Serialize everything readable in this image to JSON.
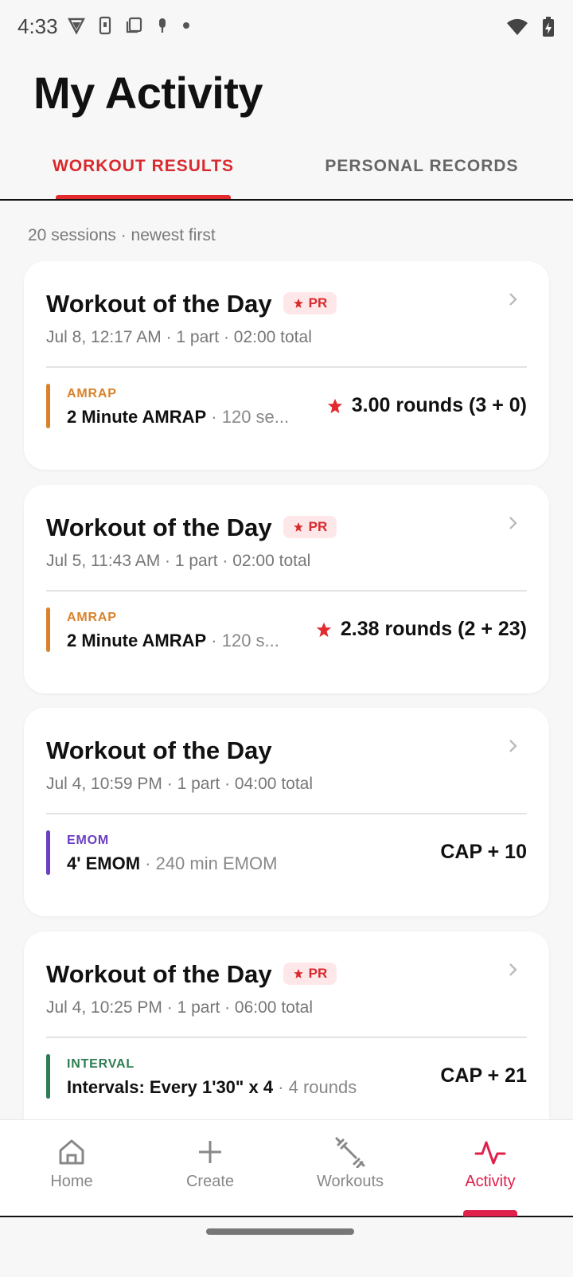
{
  "status_bar": {
    "time": "4:33"
  },
  "page": {
    "title": "My Activity"
  },
  "tabs": [
    {
      "label": "WORKOUT RESULTS",
      "active": true
    },
    {
      "label": "PERSONAL RECORDS",
      "active": false
    }
  ],
  "list_meta": "20 sessions · newest first",
  "cards": [
    {
      "title": "Workout of the Day",
      "badge": "PR",
      "subtitle": "Jul 8, 12:17 AM · 1 part · 02:00 total",
      "part_type": "AMRAP",
      "part_color": "#d9822b",
      "part_name": "2 Minute AMRAP",
      "part_desc": " · 120 se...",
      "score": "3.00 rounds (3 + 0)",
      "score_pr": true
    },
    {
      "title": "Workout of the Day",
      "badge": "PR",
      "subtitle": "Jul 5, 11:43 AM · 1 part · 02:00 total",
      "part_type": "AMRAP",
      "part_color": "#d9822b",
      "part_name": "2 Minute AMRAP",
      "part_desc": " · 120 s...",
      "score": "2.38 rounds (2 + 23)",
      "score_pr": true
    },
    {
      "title": "Workout of the Day",
      "subtitle": "Jul 4, 10:59 PM · 1 part · 04:00 total",
      "part_type": "EMOM",
      "part_color": "#6a3fc1",
      "part_name": "4' EMOM",
      "part_desc": " · 240 min EMOM",
      "score": "CAP + 10",
      "score_pr": false
    },
    {
      "title": "Workout of the Day",
      "badge": "PR",
      "subtitle": "Jul 4, 10:25 PM · 1 part · 06:00 total",
      "part_type": "INTERVAL",
      "part_color": "#2e7d52",
      "part_name": "Intervals: Every 1'30\" x 4",
      "part_desc": " · 4 rounds",
      "score": "CAP + 21",
      "score_pr": false
    }
  ],
  "bottom_nav": [
    {
      "label": "Home",
      "icon": "home-icon",
      "active": false
    },
    {
      "label": "Create",
      "icon": "plus-icon",
      "active": false
    },
    {
      "label": "Workouts",
      "icon": "dumbbell-icon",
      "active": false
    },
    {
      "label": "Activity",
      "icon": "activity-pulse-icon",
      "active": true
    }
  ],
  "colors": {
    "accent": "#e32b2f",
    "nav_active": "#e0204a"
  }
}
